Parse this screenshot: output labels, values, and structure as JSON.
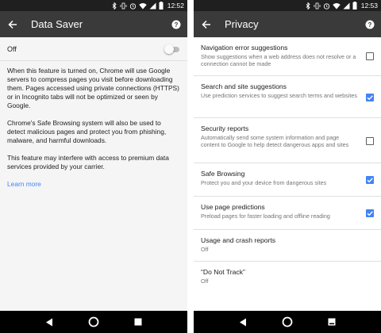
{
  "left_screen": {
    "status": {
      "time": "12:52"
    },
    "toolbar": {
      "title": "Data Saver"
    },
    "toggle_row": {
      "label": "Off",
      "checked": false
    },
    "paragraphs": [
      "When this feature is turned on, Chrome will use Google servers to compress pages you visit before downloading them. Pages accessed using private connections (HTTPS) or in Incognito tabs will not be optimized or seen by Google.",
      "Chrome's Safe Browsing system will also be used to detect malicious pages and protect you from phishing, malware, and harmful downloads.",
      "This feature may interfere with access to premium data services provided by your carrier."
    ],
    "learn_more": "Learn more"
  },
  "right_screen": {
    "status": {
      "time": "12:53"
    },
    "toolbar": {
      "title": "Privacy"
    },
    "settings": [
      {
        "title": "Navigation error suggestions",
        "summary": "Show suggestions when a web address does not resolve or a connection cannot be made",
        "checkbox": true,
        "checked": false
      },
      {
        "title": "Search and site suggestions",
        "summary": "Use prediction services to suggest search terms and websites",
        "checkbox": true,
        "checked": true
      },
      {
        "title": "Security reports",
        "summary": "Automatically send some system information and page content to Google to help detect dangerous apps and sites",
        "checkbox": true,
        "checked": false
      },
      {
        "title": "Safe Browsing",
        "summary": "Protect you and your device from dangerous sites",
        "checkbox": true,
        "checked": true
      },
      {
        "title": "Use page predictions",
        "summary": "Preload pages for faster loading and offline reading",
        "checkbox": true,
        "checked": true
      },
      {
        "title": "Usage and crash reports",
        "summary": "Off",
        "checkbox": false
      },
      {
        "title": "“Do Not Track”",
        "summary": "Off",
        "checkbox": false
      }
    ]
  },
  "icons": {
    "status": [
      "bluetooth-icon",
      "vibrate-icon",
      "alarm-icon",
      "wifi-icon",
      "signal-icon",
      "battery-icon"
    ],
    "toolbar": [
      "back-arrow-icon",
      "help-icon"
    ],
    "nav": [
      "nav-back-icon",
      "nav-home-icon",
      "nav-recents-icon"
    ]
  },
  "colors": {
    "accent": "#4285f4",
    "toolbar": "#3a3a3a",
    "status_bar": "#1f1f1f"
  }
}
